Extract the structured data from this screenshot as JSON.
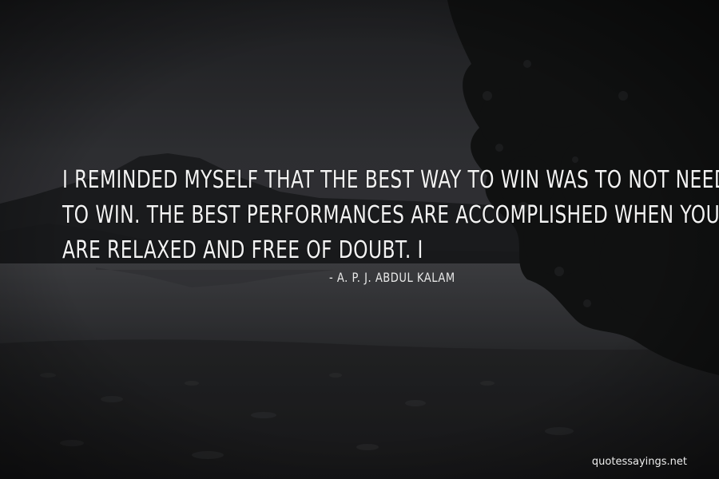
{
  "quote": {
    "lines": [
      "I REMINDED MYSELF THAT THE BEST WAY TO WIN WAS TO NOT NEED",
      "TO WIN. THE BEST PERFORMANCES ARE ACCOMPLISHED WHEN YOU",
      "ARE RELAXED AND FREE OF DOUBT. I"
    ],
    "author": "- A. P. J. ABDUL KALAM"
  },
  "watermark": "quotessayings.net",
  "colors": {
    "text": "#f2f2f2",
    "sky": "#3a3b3f",
    "water": "#4a4b4e",
    "mountain": "#1e1f22",
    "foliage": "#141515"
  }
}
